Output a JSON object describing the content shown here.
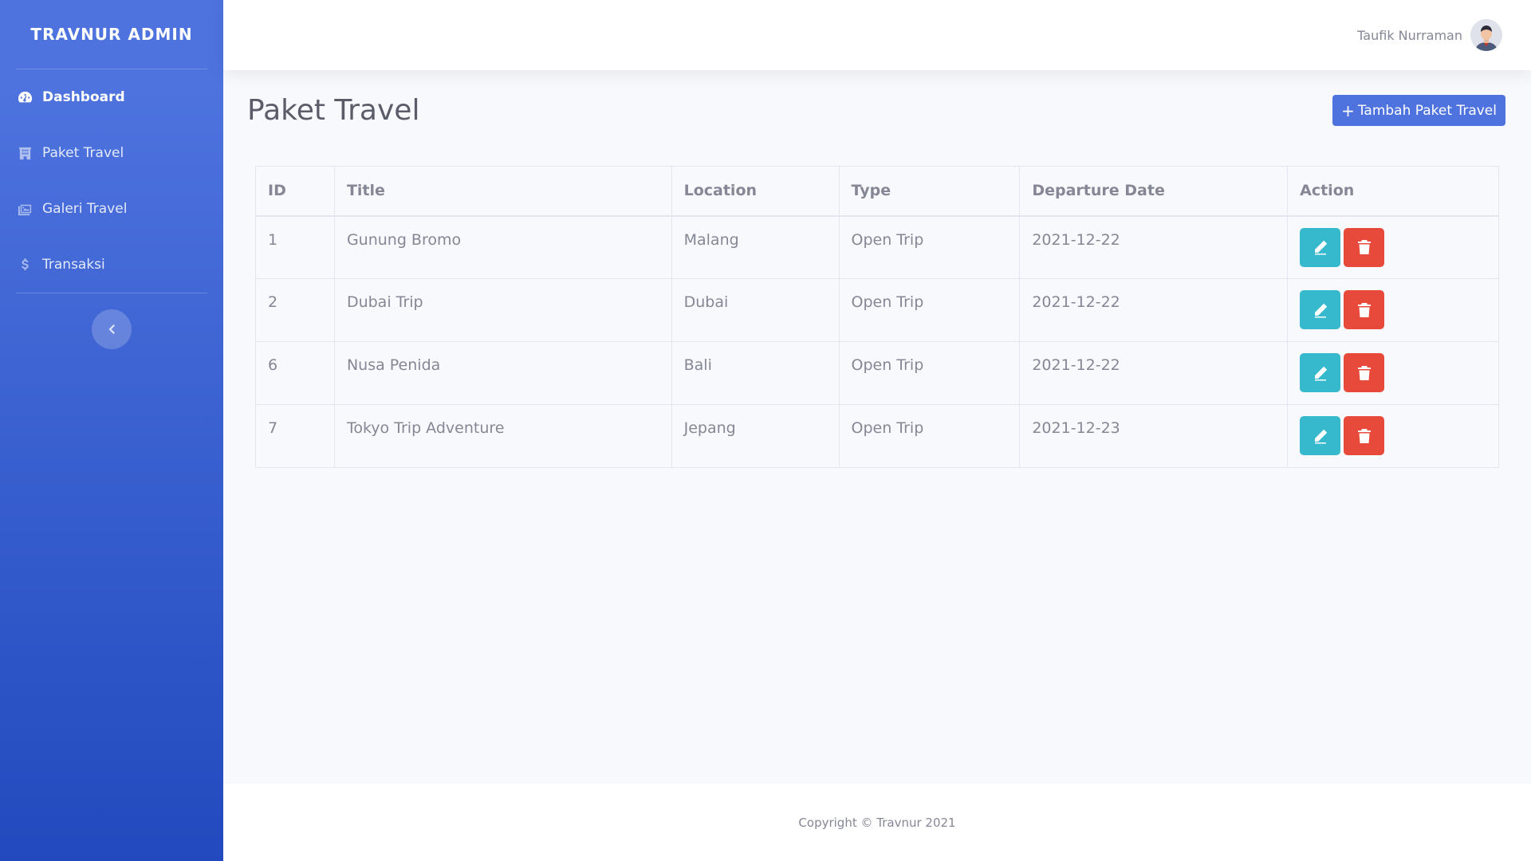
{
  "sidebar": {
    "brand": "TRAVNUR ADMIN",
    "items": [
      {
        "label": "Dashboard",
        "icon": "tachometer-icon",
        "active": true
      },
      {
        "label": "Paket Travel",
        "icon": "building-icon",
        "active": false
      },
      {
        "label": "Galeri Travel",
        "icon": "images-icon",
        "active": false
      },
      {
        "label": "Transaksi",
        "icon": "dollar-icon",
        "active": false
      }
    ],
    "toggle_icon": "chevron-left-icon"
  },
  "topbar": {
    "user_name": "Taufik Nurraman",
    "avatar_icon": "user-avatar-icon"
  },
  "page": {
    "title": "Paket Travel",
    "add_button_label": "Tambah Paket Travel",
    "add_button_icon": "plus-icon"
  },
  "table": {
    "headers": [
      "ID",
      "Title",
      "Location",
      "Type",
      "Departure Date",
      "Action"
    ],
    "rows": [
      {
        "id": "1",
        "title": "Gunung Bromo",
        "location": "Malang",
        "type": "Open Trip",
        "departure_date": "2021-12-22"
      },
      {
        "id": "2",
        "title": "Dubai Trip",
        "location": "Dubai",
        "type": "Open Trip",
        "departure_date": "2021-12-22"
      },
      {
        "id": "6",
        "title": "Nusa Penida",
        "location": "Bali",
        "type": "Open Trip",
        "departure_date": "2021-12-22"
      },
      {
        "id": "7",
        "title": "Tokyo Trip Adventure",
        "location": "Jepang",
        "type": "Open Trip",
        "departure_date": "2021-12-23"
      }
    ]
  },
  "footer": {
    "copyright": "Copyright © Travnur 2021"
  },
  "colors": {
    "primary": "#4e73df",
    "info": "#36b9cc",
    "danger": "#e74a3b",
    "sidebar_gradient_end": "#224abe"
  }
}
